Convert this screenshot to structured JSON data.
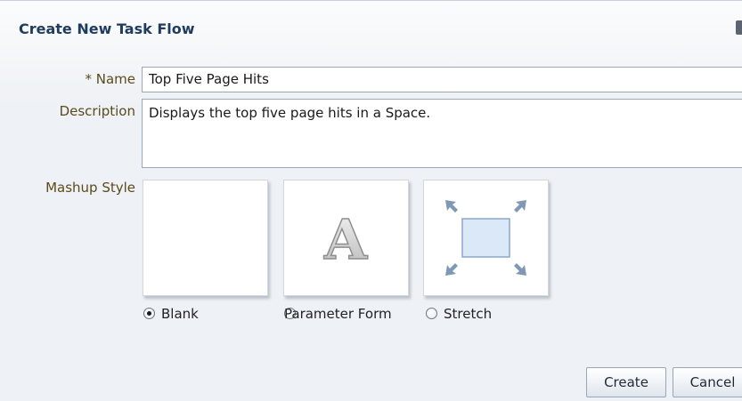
{
  "dialog": {
    "title": "Create New Task Flow"
  },
  "form": {
    "name": {
      "required_marker": "*",
      "label": "Name",
      "value": "Top Five Page Hits"
    },
    "description": {
      "label": "Description",
      "value": "Displays the top five page hits in a Space."
    },
    "mashup_style": {
      "label": "Mashup Style",
      "selected": "Blank",
      "options": [
        {
          "label": "Blank",
          "icon": "blank-tile",
          "checked": true
        },
        {
          "label": "Parameter Form",
          "icon": "letter-a-icon",
          "checked": false
        },
        {
          "label": "Stretch",
          "icon": "stretch-arrows-icon",
          "checked": false
        }
      ]
    }
  },
  "buttons": {
    "create": "Create",
    "cancel": "Cancel"
  },
  "colors": {
    "title": "#1f3c5c",
    "label": "#5c4a1a",
    "stretch_box": "#dbe8f7"
  }
}
